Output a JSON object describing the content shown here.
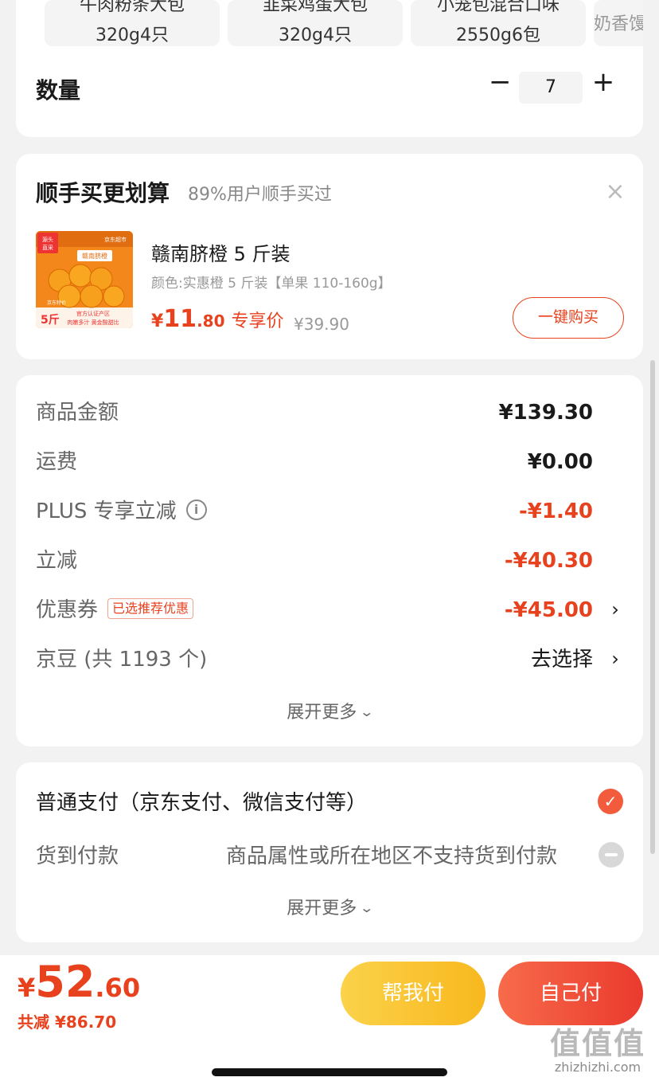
{
  "spec_chips": [
    {
      "line1": "牛肉粉条大包",
      "line2": "320g4只"
    },
    {
      "line1": "韭菜鸡蛋大包",
      "line2": "320g4只"
    },
    {
      "line1": "小笼包混合口味",
      "line2": "2550g6包"
    },
    {
      "line1": "",
      "line2": "奶香馒"
    }
  ],
  "quantity": {
    "label": "数量",
    "minus": "−",
    "value": "7",
    "plus": "+"
  },
  "upsell": {
    "title": "顺手买更划算",
    "subtitle": "89%用户顺手买过",
    "close": "×",
    "product": {
      "name": "赣南脐橙 5 斤装",
      "spec": "颜色:实惠橙 5 斤装【单果 110-160g】",
      "price_currency": "¥",
      "price_int": "11",
      "price_dec": ".80",
      "price_tag": "专享价",
      "original_price": "¥39.90",
      "buy_label": "一键购买",
      "image_text": {
        "badge1": "源头",
        "badge2": "直采",
        "brand": "赣南脐橙",
        "weight": "5斤",
        "slogan": "肉嫩多汁 黄金酸甜比",
        "corner": "京东超市",
        "cert": "官方认证产区",
        "tag": "京东特价"
      }
    }
  },
  "summary": {
    "rows": [
      {
        "label": "商品金额",
        "value": "¥139.30"
      },
      {
        "label": "运费",
        "value": "¥0.00"
      },
      {
        "label": "PLUS 专享立减",
        "value": "-¥1.40"
      },
      {
        "label": "立减",
        "value": "-¥40.30"
      },
      {
        "label": "优惠券",
        "tag": "已选推荐优惠",
        "value": "-¥45.00"
      },
      {
        "label": "京豆 (共 1193 个)",
        "value": "去选择"
      }
    ],
    "info_icon": "i",
    "arrow": "›",
    "expand_label": "展开更多"
  },
  "payment": {
    "option1": "普通支付（京东支付、微信支付等）",
    "option2": "货到付款",
    "option2_note": "商品属性或所在地区不支持货到付款",
    "check": "✓",
    "expand_label": "展开更多"
  },
  "bottom": {
    "currency": "¥",
    "total_int": "52",
    "total_dec": ".60",
    "saved": "共减 ¥86.70",
    "help_pay": "帮我付",
    "self_pay": "自己付",
    "watermark": "值值值",
    "watermark_url": "zhizhizhi.com"
  },
  "colors": {
    "accent": "#e8411e",
    "help_button": "#f8b81e",
    "self_button": "#ea3a2e"
  }
}
